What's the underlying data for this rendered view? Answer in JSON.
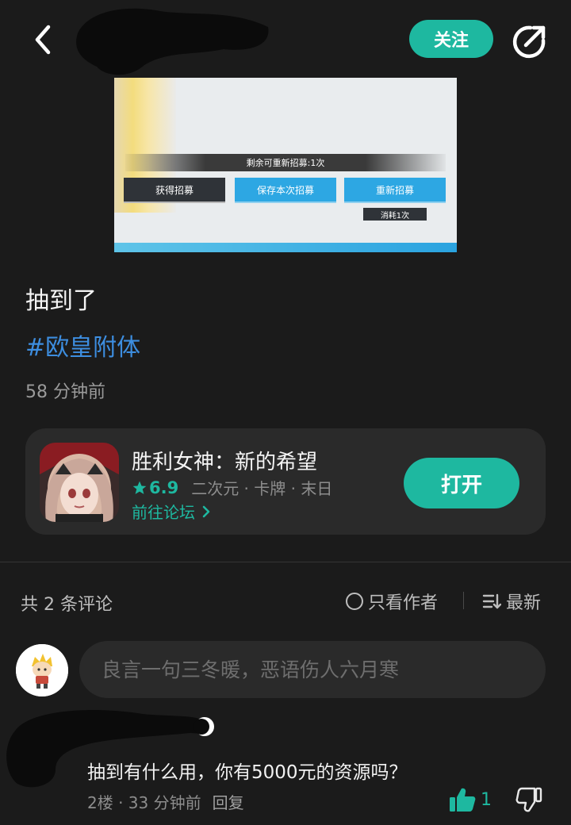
{
  "header": {
    "follow_label": "关注"
  },
  "post_image": {
    "remaining_text": "剩余可重新招募:1次",
    "get_label": "获得招募",
    "save_label": "保存本次招募",
    "re_recruit_label": "重新招募",
    "cost_label": "消耗1次"
  },
  "post": {
    "title": "抽到了",
    "hashtag": "#欧皇附体",
    "time": "58 分钟前"
  },
  "game": {
    "name": "胜利女神：新的希望",
    "rating": "6.9",
    "tags": "二次元 · 卡牌 · 末日",
    "forum_link": "前往论坛",
    "open_label": "打开"
  },
  "comments_bar": {
    "count_label": "共 2 条评论",
    "only_author_label": "只看作者",
    "sort_label": "最新"
  },
  "comment_input": {
    "placeholder": "良言一句三冬暖，恶语伤人六月寒"
  },
  "comment": {
    "text": "抽到有什么用，你有5000元的资源吗？",
    "meta": "2楼 · 33 分钟前",
    "reply_label": "回复",
    "likes": "1"
  },
  "colors": {
    "accent": "#1eb8a0",
    "hashtag": "#3d8ee0",
    "background": "#1b1b1b",
    "card": "#2a2a2a"
  }
}
